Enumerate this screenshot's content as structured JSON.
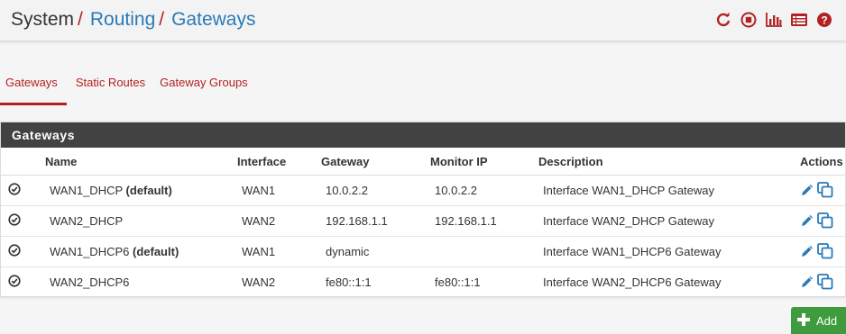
{
  "breadcrumb": {
    "root": "System",
    "sep": "/",
    "level2": "Routing",
    "level3": "Gateways"
  },
  "header_icons": [
    "reload-icon",
    "stop-icon",
    "bar-chart-icon",
    "list-icon",
    "help-icon"
  ],
  "tabs": [
    {
      "label": "Gateways",
      "active": true
    },
    {
      "label": "Static Routes",
      "active": false
    },
    {
      "label": "Gateway Groups",
      "active": false
    }
  ],
  "panel": {
    "title": "Gateways",
    "columns": {
      "name": "Name",
      "interface": "Interface",
      "gateway": "Gateway",
      "monitor": "Monitor IP",
      "description": "Description",
      "actions": "Actions"
    },
    "rows": [
      {
        "name": "WAN1_DHCP",
        "default": "(default)",
        "interface": "WAN1",
        "gateway": "10.0.2.2",
        "monitor": "10.0.2.2",
        "description": "Interface WAN1_DHCP Gateway"
      },
      {
        "name": "WAN2_DHCP",
        "default": "",
        "interface": "WAN2",
        "gateway": "192.168.1.1",
        "monitor": "192.168.1.1",
        "description": "Interface WAN2_DHCP Gateway"
      },
      {
        "name": "WAN1_DHCP6",
        "default": "(default)",
        "interface": "WAN1",
        "gateway": "dynamic",
        "monitor": "",
        "description": "Interface WAN1_DHCP6 Gateway"
      },
      {
        "name": "WAN2_DHCP6",
        "default": "",
        "interface": "WAN2",
        "gateway": "fe80::1:1",
        "monitor": "fe80::1:1",
        "description": "Interface WAN2_DHCP6 Gateway"
      }
    ]
  },
  "add_button": {
    "label": "Add"
  },
  "colors": {
    "accent_red": "#b22222",
    "link_blue": "#2a7ab8",
    "panel_header": "#424242",
    "action_blue": "#2a7ab8",
    "add_green": "#3e9b3e"
  }
}
